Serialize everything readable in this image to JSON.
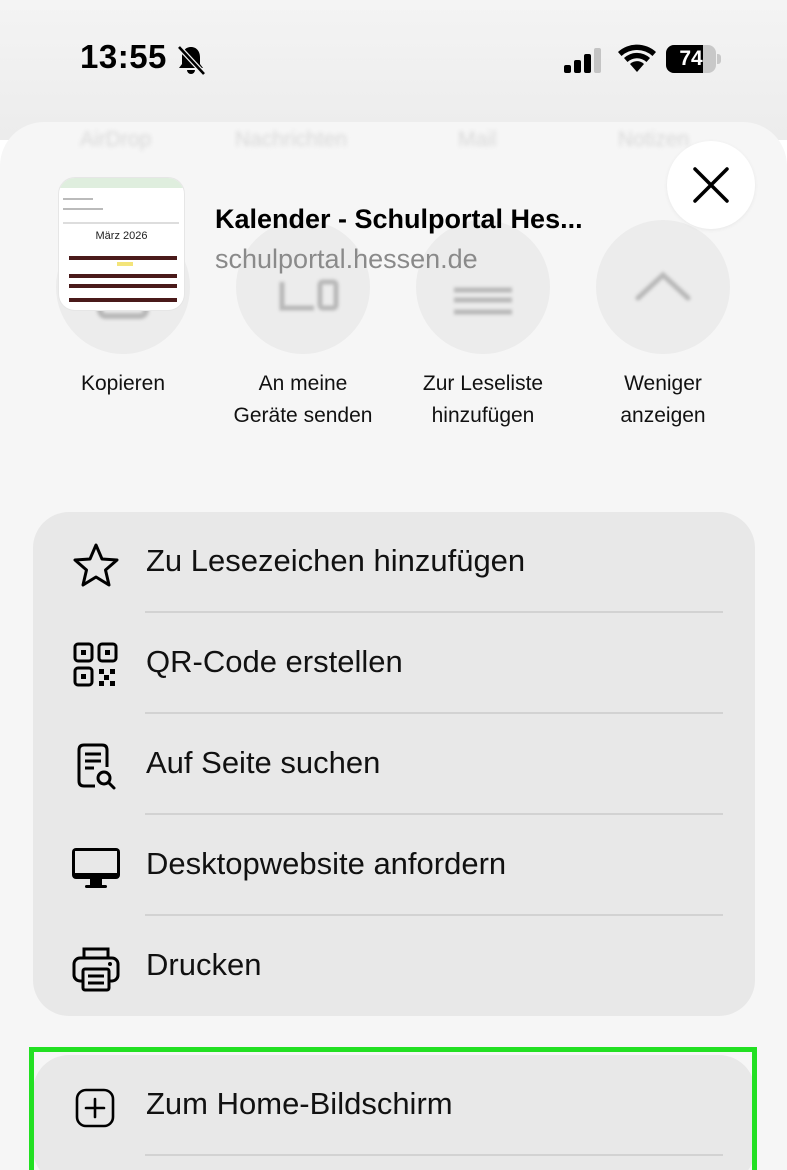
{
  "status_bar": {
    "time": "13:55",
    "battery_percent": "74",
    "battery_level": 0.74,
    "icons": [
      "bell-slash-icon",
      "cellular-signal-icon",
      "wifi-icon",
      "battery-icon"
    ]
  },
  "share_sheet": {
    "page_title": "Kalender - Schulportal Hes...",
    "page_url": "schulportal.hessen.de",
    "thumbnail": {
      "heading": "März 2026"
    },
    "faded_app_row": [
      "AirDrop",
      "Nachrichten",
      "Mail",
      "Notizen"
    ],
    "actions": [
      {
        "label": "Kopieren",
        "icon": "copy-icon"
      },
      {
        "label": "An meine Geräte senden",
        "icon": "devices-icon"
      },
      {
        "label": "Zur Leseliste hinzufügen",
        "icon": "reading-list-icon"
      },
      {
        "label": "Weniger anzeigen",
        "icon": "chevron-up-icon"
      }
    ],
    "menu": [
      {
        "label": "Zu Lesezeichen hinzufügen",
        "icon": "star-icon"
      },
      {
        "label": "QR-Code erstellen",
        "icon": "qr-code-icon"
      },
      {
        "label": "Auf Seite suchen",
        "icon": "find-on-page-icon"
      },
      {
        "label": "Desktopwebsite anfordern",
        "icon": "desktop-icon"
      },
      {
        "label": "Drucken",
        "icon": "printer-icon"
      }
    ],
    "menu2": [
      {
        "label": "Zum Home-Bildschirm",
        "icon": "add-square-icon"
      }
    ]
  },
  "colors": {
    "highlight": "#22e022",
    "group_background": "#e8e8e8",
    "sheet_background": "#f6f6f6"
  }
}
